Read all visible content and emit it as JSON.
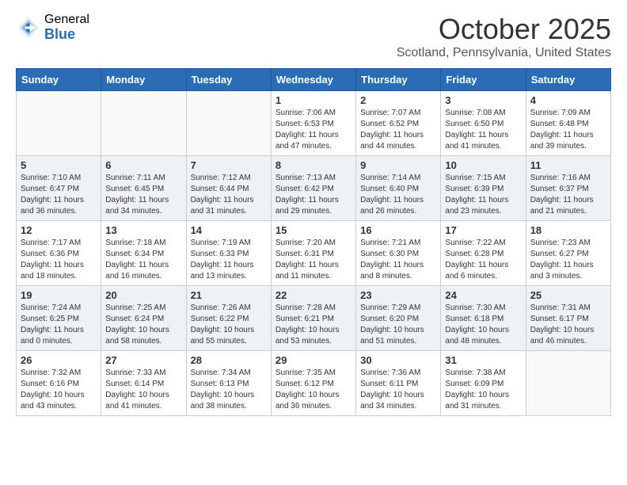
{
  "header": {
    "logo_general": "General",
    "logo_blue": "Blue",
    "month_title": "October 2025",
    "subtitle": "Scotland, Pennsylvania, United States"
  },
  "days_of_week": [
    "Sunday",
    "Monday",
    "Tuesday",
    "Wednesday",
    "Thursday",
    "Friday",
    "Saturday"
  ],
  "weeks": [
    [
      {
        "day": "",
        "info": ""
      },
      {
        "day": "",
        "info": ""
      },
      {
        "day": "",
        "info": ""
      },
      {
        "day": "1",
        "info": "Sunrise: 7:06 AM\nSunset: 6:53 PM\nDaylight: 11 hours and 47 minutes."
      },
      {
        "day": "2",
        "info": "Sunrise: 7:07 AM\nSunset: 6:52 PM\nDaylight: 11 hours and 44 minutes."
      },
      {
        "day": "3",
        "info": "Sunrise: 7:08 AM\nSunset: 6:50 PM\nDaylight: 11 hours and 41 minutes."
      },
      {
        "day": "4",
        "info": "Sunrise: 7:09 AM\nSunset: 6:48 PM\nDaylight: 11 hours and 39 minutes."
      }
    ],
    [
      {
        "day": "5",
        "info": "Sunrise: 7:10 AM\nSunset: 6:47 PM\nDaylight: 11 hours and 36 minutes."
      },
      {
        "day": "6",
        "info": "Sunrise: 7:11 AM\nSunset: 6:45 PM\nDaylight: 11 hours and 34 minutes."
      },
      {
        "day": "7",
        "info": "Sunrise: 7:12 AM\nSunset: 6:44 PM\nDaylight: 11 hours and 31 minutes."
      },
      {
        "day": "8",
        "info": "Sunrise: 7:13 AM\nSunset: 6:42 PM\nDaylight: 11 hours and 29 minutes."
      },
      {
        "day": "9",
        "info": "Sunrise: 7:14 AM\nSunset: 6:40 PM\nDaylight: 11 hours and 26 minutes."
      },
      {
        "day": "10",
        "info": "Sunrise: 7:15 AM\nSunset: 6:39 PM\nDaylight: 11 hours and 23 minutes."
      },
      {
        "day": "11",
        "info": "Sunrise: 7:16 AM\nSunset: 6:37 PM\nDaylight: 11 hours and 21 minutes."
      }
    ],
    [
      {
        "day": "12",
        "info": "Sunrise: 7:17 AM\nSunset: 6:36 PM\nDaylight: 11 hours and 18 minutes."
      },
      {
        "day": "13",
        "info": "Sunrise: 7:18 AM\nSunset: 6:34 PM\nDaylight: 11 hours and 16 minutes."
      },
      {
        "day": "14",
        "info": "Sunrise: 7:19 AM\nSunset: 6:33 PM\nDaylight: 11 hours and 13 minutes."
      },
      {
        "day": "15",
        "info": "Sunrise: 7:20 AM\nSunset: 6:31 PM\nDaylight: 11 hours and 11 minutes."
      },
      {
        "day": "16",
        "info": "Sunrise: 7:21 AM\nSunset: 6:30 PM\nDaylight: 11 hours and 8 minutes."
      },
      {
        "day": "17",
        "info": "Sunrise: 7:22 AM\nSunset: 6:28 PM\nDaylight: 11 hours and 6 minutes."
      },
      {
        "day": "18",
        "info": "Sunrise: 7:23 AM\nSunset: 6:27 PM\nDaylight: 11 hours and 3 minutes."
      }
    ],
    [
      {
        "day": "19",
        "info": "Sunrise: 7:24 AM\nSunset: 6:25 PM\nDaylight: 11 hours and 0 minutes."
      },
      {
        "day": "20",
        "info": "Sunrise: 7:25 AM\nSunset: 6:24 PM\nDaylight: 10 hours and 58 minutes."
      },
      {
        "day": "21",
        "info": "Sunrise: 7:26 AM\nSunset: 6:22 PM\nDaylight: 10 hours and 55 minutes."
      },
      {
        "day": "22",
        "info": "Sunrise: 7:28 AM\nSunset: 6:21 PM\nDaylight: 10 hours and 53 minutes."
      },
      {
        "day": "23",
        "info": "Sunrise: 7:29 AM\nSunset: 6:20 PM\nDaylight: 10 hours and 51 minutes."
      },
      {
        "day": "24",
        "info": "Sunrise: 7:30 AM\nSunset: 6:18 PM\nDaylight: 10 hours and 48 minutes."
      },
      {
        "day": "25",
        "info": "Sunrise: 7:31 AM\nSunset: 6:17 PM\nDaylight: 10 hours and 46 minutes."
      }
    ],
    [
      {
        "day": "26",
        "info": "Sunrise: 7:32 AM\nSunset: 6:16 PM\nDaylight: 10 hours and 43 minutes."
      },
      {
        "day": "27",
        "info": "Sunrise: 7:33 AM\nSunset: 6:14 PM\nDaylight: 10 hours and 41 minutes."
      },
      {
        "day": "28",
        "info": "Sunrise: 7:34 AM\nSunset: 6:13 PM\nDaylight: 10 hours and 38 minutes."
      },
      {
        "day": "29",
        "info": "Sunrise: 7:35 AM\nSunset: 6:12 PM\nDaylight: 10 hours and 36 minutes."
      },
      {
        "day": "30",
        "info": "Sunrise: 7:36 AM\nSunset: 6:11 PM\nDaylight: 10 hours and 34 minutes."
      },
      {
        "day": "31",
        "info": "Sunrise: 7:38 AM\nSunset: 6:09 PM\nDaylight: 10 hours and 31 minutes."
      },
      {
        "day": "",
        "info": ""
      }
    ]
  ]
}
